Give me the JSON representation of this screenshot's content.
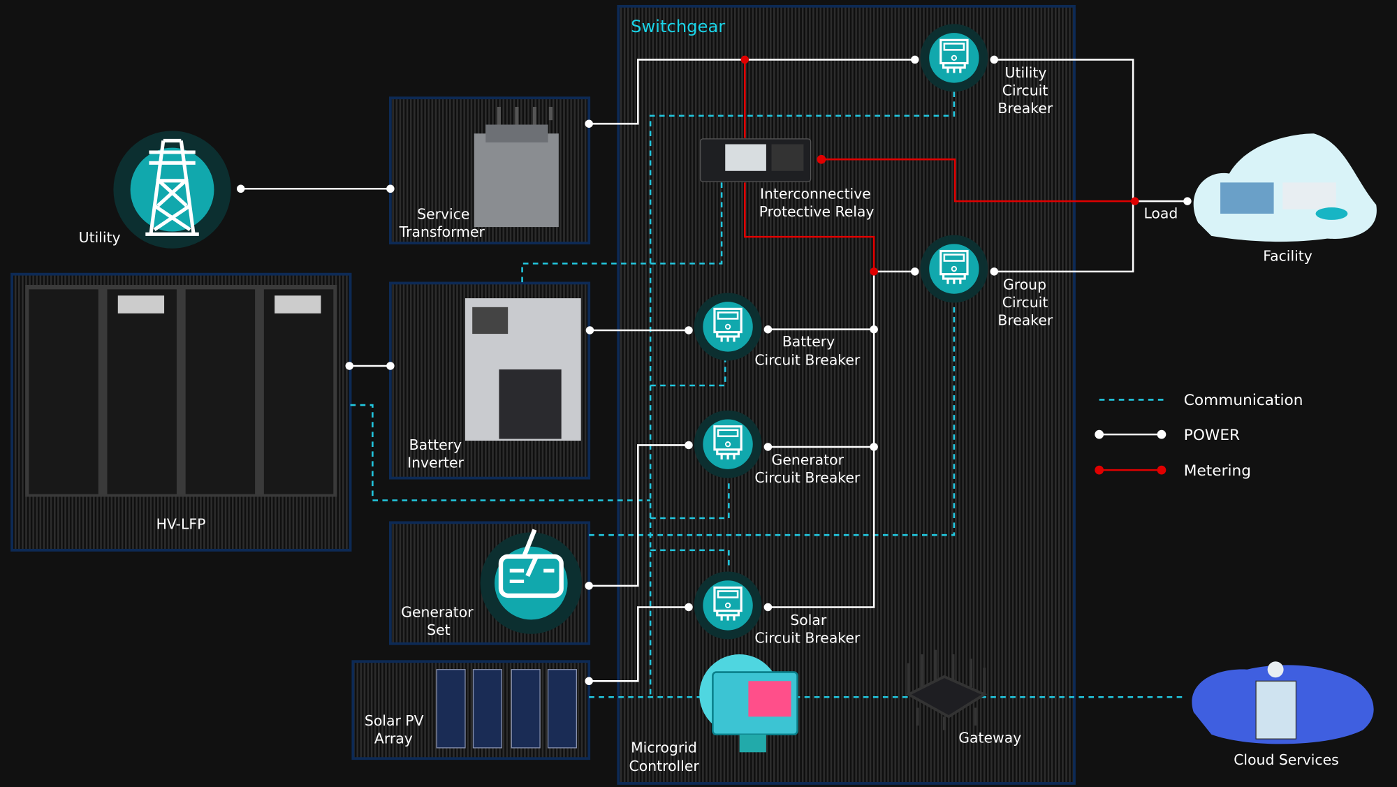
{
  "colors": {
    "background": "#111111",
    "power": "#ffffff",
    "metering": "#e00000",
    "communication": "#22c8e0",
    "teal": "#11a8ad",
    "panel_border": "#0d2a55",
    "switchgear_title": "#1ad4e8"
  },
  "switchgear": {
    "title": "Switchgear"
  },
  "nodes": {
    "utility": {
      "label": "Utility"
    },
    "service_transformer": {
      "line1": "Service",
      "line2": "Transformer"
    },
    "battery_inverter": {
      "line1": "Battery",
      "line2": "Inverter"
    },
    "hv_lfp": {
      "label": "HV-LFP"
    },
    "generator_set": {
      "line1": "Generator",
      "line2": "Set"
    },
    "solar_pv": {
      "line1": "Solar PV",
      "line2": "Array"
    },
    "relay": {
      "line1": "Interconnective",
      "line2": "Protective Relay"
    },
    "utility_cb": {
      "line1": "Utility",
      "line2": "Circuit",
      "line3": "Breaker"
    },
    "group_cb": {
      "line1": "Group",
      "line2": "Circuit",
      "line3": "Breaker"
    },
    "battery_cb": {
      "line1": "Battery",
      "line2": "Circuit Breaker"
    },
    "generator_cb": {
      "line1": "Generator",
      "line2": "Circuit Breaker"
    },
    "solar_cb": {
      "line1": "Solar",
      "line2": "Circuit Breaker"
    },
    "microgrid_controller": {
      "line1": "Microgrid",
      "line2": "Controller"
    },
    "gateway": {
      "label": "Gateway"
    },
    "load": {
      "label": "Load"
    },
    "facility": {
      "label": "Facility"
    },
    "cloud": {
      "label": "Cloud Services"
    }
  },
  "legend": [
    {
      "label": "Communication",
      "style": "dashed",
      "color": "#22c8e0"
    },
    {
      "label": "POWER",
      "style": "solid",
      "color": "#ffffff"
    },
    {
      "label": "Metering",
      "style": "solid",
      "color": "#e00000"
    }
  ]
}
